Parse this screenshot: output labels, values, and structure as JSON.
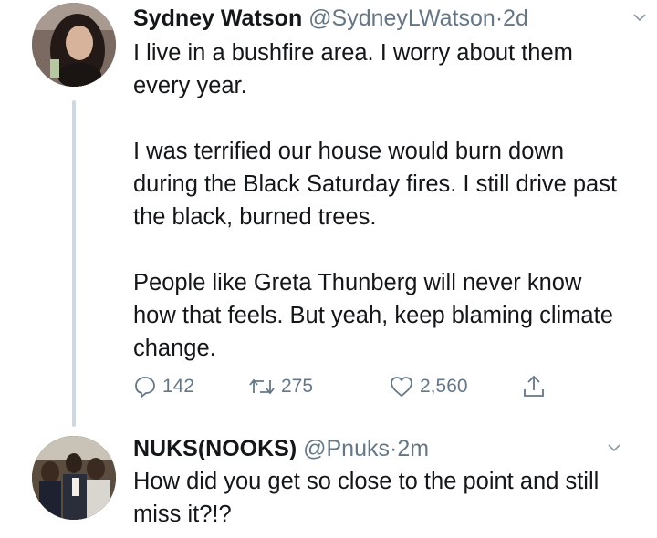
{
  "tweets": [
    {
      "author_name": "Sydney Watson",
      "handle": "@SydneyLWatson",
      "separator": "·",
      "time": "2d",
      "paragraphs": [
        "I live in a bushfire area. I worry about them every year.",
        "I was terrified our house would burn down during the Black Saturday fires. I still drive past the black, burned trees.",
        "People like Greta Thunberg will never know how that feels. But yeah, keep blaming climate change."
      ],
      "actions": {
        "replies": "142",
        "retweets": "275",
        "likes": "2,560"
      }
    },
    {
      "author_name": "NUKS(NOOKS)",
      "handle": "@Pnuks",
      "separator": "·",
      "time": "2m",
      "paragraphs": [
        "How did you get so close to the point and still miss it?!?"
      ]
    }
  ],
  "icons": {
    "reply": "reply-icon",
    "retweet": "retweet-icon",
    "like": "heart-icon",
    "share": "share-icon",
    "more": "chevron-down-icon"
  },
  "colors": {
    "text": "#14171a",
    "secondary": "#657786",
    "thread_line": "#cfd8de",
    "background": "#ffffff"
  }
}
